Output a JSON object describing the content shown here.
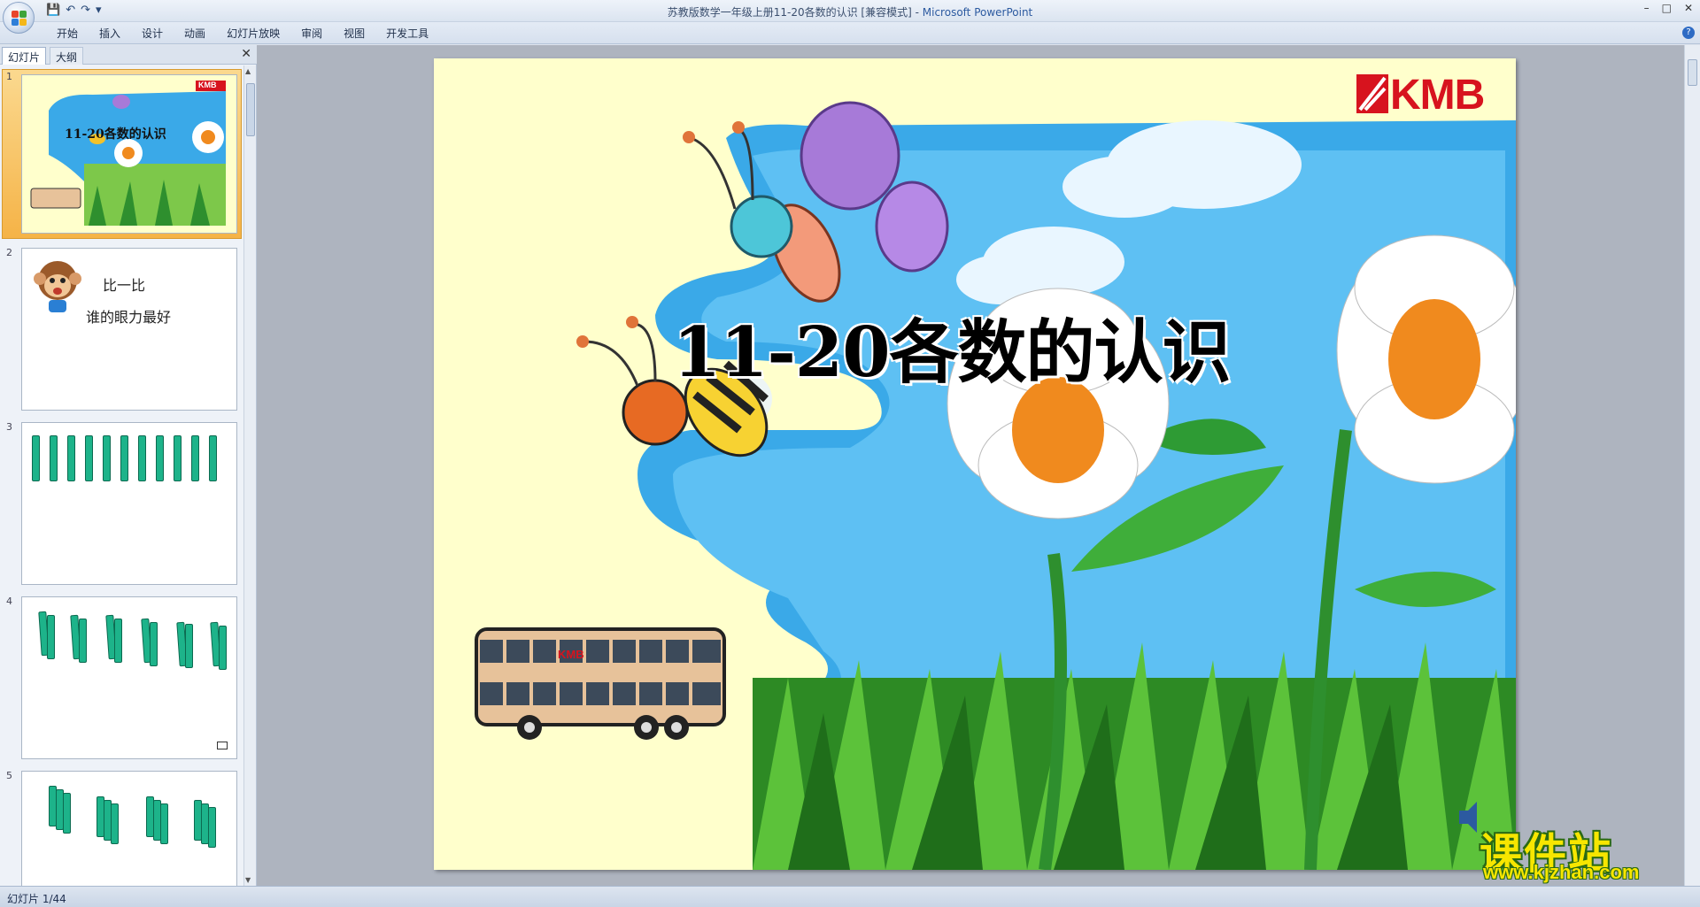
{
  "window": {
    "title_doc": "苏教版数学一年级上册11-20各数的认识 [兼容模式]",
    "title_sep": " - ",
    "title_app": "Microsoft PowerPoint"
  },
  "qat": {
    "save": "💾",
    "undo": "↶",
    "redo": "↷",
    "more": "▾"
  },
  "window_controls": {
    "min": "–",
    "max": "□",
    "close": "✕"
  },
  "ribbon": {
    "tabs": [
      "开始",
      "插入",
      "设计",
      "动画",
      "幻灯片放映",
      "审阅",
      "视图",
      "开发工具"
    ],
    "help": "?"
  },
  "pane": {
    "tab_slides": "幻灯片",
    "tab_outline": "大纲",
    "close": "✕"
  },
  "thumbnails": [
    {
      "num": "1",
      "title": "11-20各数的认识",
      "logo": "KMB"
    },
    {
      "num": "2",
      "line1": "比一比",
      "line2": "谁的眼力最好"
    },
    {
      "num": "3"
    },
    {
      "num": "4"
    },
    {
      "num": "5"
    }
  ],
  "slide": {
    "title": "11-20各数的认识",
    "logo": "KMB",
    "bus_logo": "KMB"
  },
  "status": {
    "slide_counter": "幻灯片 1/44"
  },
  "watermark": {
    "big": "课件站",
    "small": "www.kjzhan.com"
  },
  "colors": {
    "accent": "#2c5aa0",
    "slide_bg": "#ffffcc",
    "sky": "#33aaee",
    "selection": "#f5b347"
  }
}
